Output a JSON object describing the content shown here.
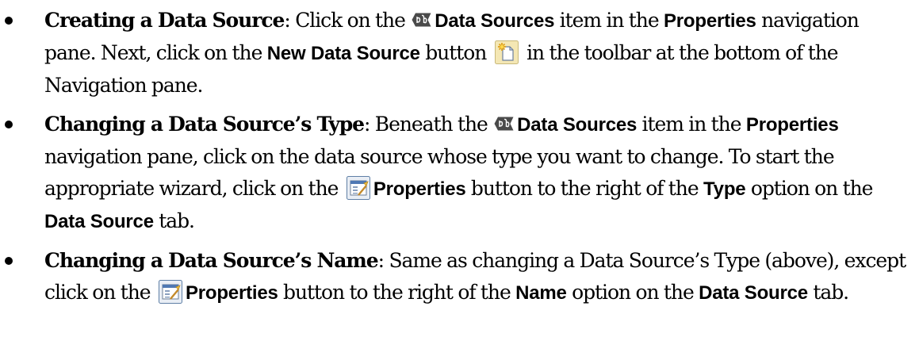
{
  "items": [
    {
      "lead": "Creating a Data Source",
      "t1": ": Click on the ",
      "icon1": "data-sources-icon",
      "b1": "Data Sources",
      "t2": " item in the ",
      "b2": "Properties",
      "t3": " navigation pane. Next, click on the ",
      "b3": "New Data Source",
      "t4": " button ",
      "icon2": "new-data-source-icon",
      "t5": " in the toolbar at the bottom of the Navigation pane."
    },
    {
      "lead": "Changing a Data Source’s Type",
      "t1": ": Beneath the ",
      "icon1": "data-sources-icon",
      "b1": "Data Sources",
      "t2": " item in the ",
      "b2": "Properties",
      "t3": " navigation pane, click on the data source whose type you want to change. To start the appropriate wizard, click on the ",
      "icon2": "properties-icon",
      "b3": "Properties",
      "t4": " button to the right of the ",
      "b4": "Type",
      "t5": " option on the ",
      "b5": "Data Source",
      "t6": " tab."
    },
    {
      "lead": "Changing a Data Source’s Name",
      "t1": ": Same as changing a Data Source’s Type (above), except click on the ",
      "icon1": "properties-icon",
      "b1": "Properties",
      "t2": " button to the right of the ",
      "b2": "Name",
      "t3": " option on the ",
      "b3": "Data Source",
      "t4": " tab."
    }
  ],
  "colors": {
    "text": "#000000",
    "background": "#ffffff",
    "new_icon_bg": "#f4e7b4",
    "properties_icon_border": "#5f7fa6"
  }
}
